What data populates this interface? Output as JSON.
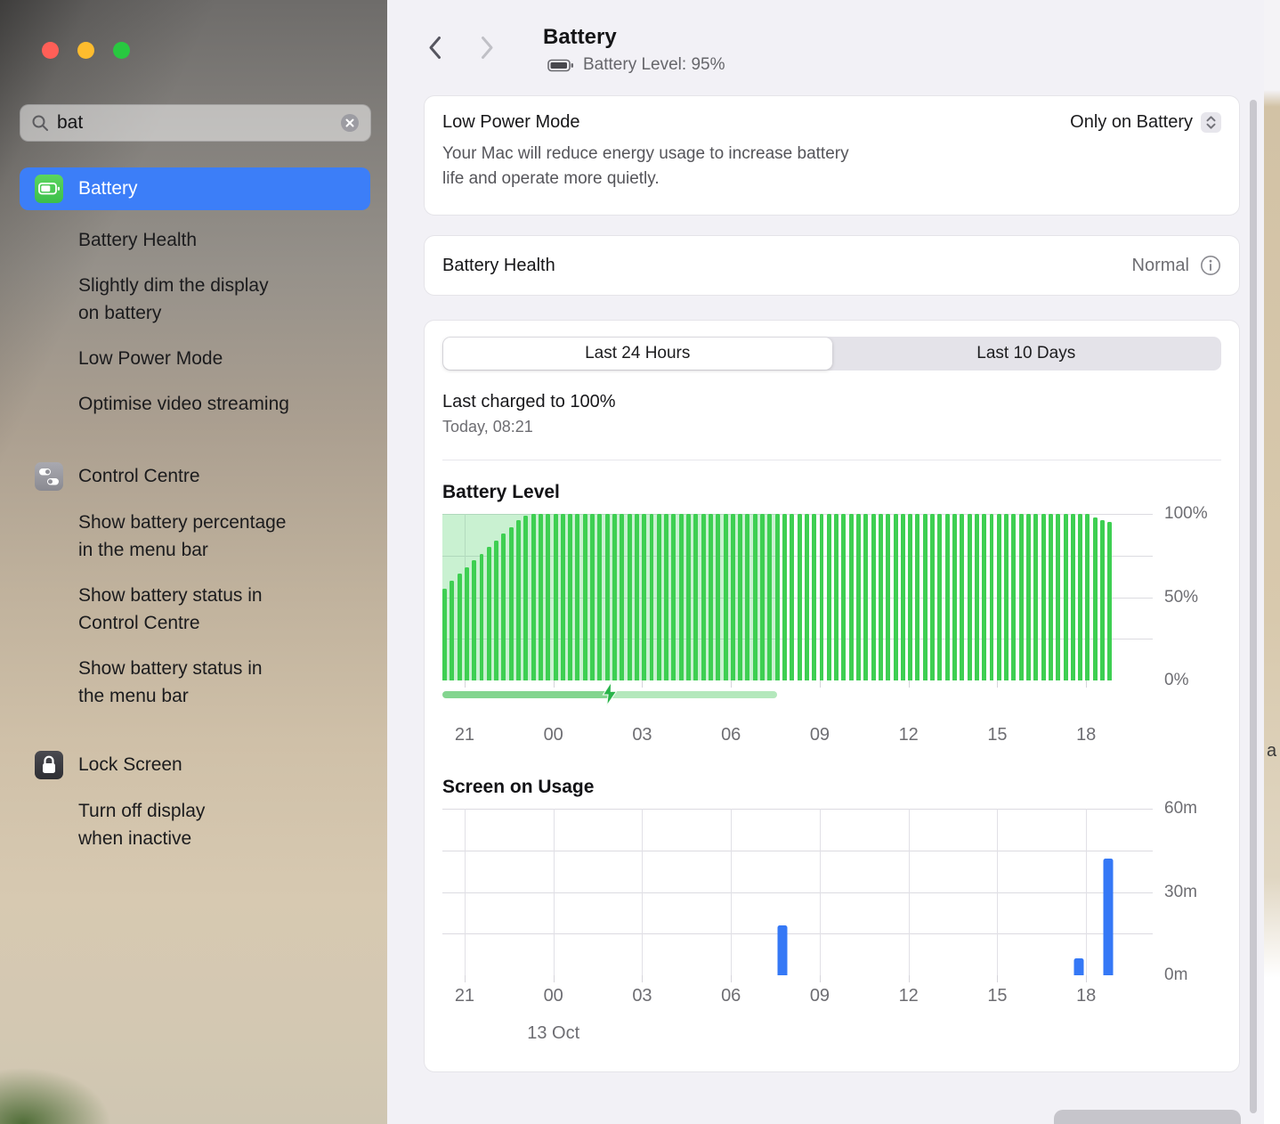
{
  "window": {
    "accent_color": "#3c7ef8",
    "traffic_lights": {
      "close": "#ff5f57",
      "minimize": "#febc2e",
      "zoom": "#28c840"
    }
  },
  "sidebar": {
    "search": {
      "value": "bat"
    },
    "items": [
      {
        "label": "Battery",
        "icon": "battery",
        "selected": true
      },
      {
        "label": "Battery Health"
      },
      {
        "label": "Slightly dim the display\non battery"
      },
      {
        "label": "Low Power Mode"
      },
      {
        "label": "Optimise video streaming"
      },
      {
        "label": "Control Centre",
        "icon": "control-centre"
      },
      {
        "label": "Show battery percentage\nin the menu bar"
      },
      {
        "label": "Show battery status in\nControl Centre"
      },
      {
        "label": "Show battery status in\nthe menu bar"
      },
      {
        "label": "Lock Screen",
        "icon": "lock"
      },
      {
        "label": "Turn off display\nwhen inactive"
      }
    ]
  },
  "main": {
    "title": "Battery",
    "battery_status": "Battery Level: 95%",
    "low_power_mode": {
      "label": "Low Power Mode",
      "value": "Only on Battery",
      "description": "Your Mac will reduce energy usage to increase battery\nlife and operate more quietly."
    },
    "battery_health": {
      "label": "Battery Health",
      "value": "Normal"
    },
    "usage_card": {
      "tabs": [
        "Last 24 Hours",
        "Last 10 Days"
      ],
      "selected_tab": "Last 24 Hours",
      "last_charged": "Last charged to 100%",
      "last_charged_time": "Today, 08:21"
    }
  },
  "desktop": {
    "text_fragment": "a"
  },
  "chart_data": [
    {
      "type": "bar",
      "title": "Battery Level",
      "x_span_hours": 24,
      "x_ticks": [
        "21",
        "00",
        "03",
        "06",
        "09",
        "12",
        "15",
        "18"
      ],
      "x_tick_start_frac": 0.03125,
      "x_tick_step_frac": 0.125,
      "y_ticks": [
        "100%",
        "50%",
        "0%"
      ],
      "ylim": [
        0,
        100
      ],
      "grid": true,
      "bar_color": "#3ecf52",
      "values": [
        55,
        60,
        64,
        68,
        72,
        76,
        80,
        84,
        88,
        92,
        96,
        99,
        100,
        100,
        100,
        100,
        100,
        100,
        100,
        100,
        100,
        100,
        100,
        100,
        100,
        100,
        100,
        100,
        100,
        100,
        100,
        100,
        100,
        100,
        100,
        100,
        100,
        100,
        100,
        100,
        100,
        100,
        100,
        100,
        100,
        100,
        100,
        100,
        100,
        100,
        100,
        100,
        100,
        100,
        100,
        100,
        100,
        100,
        100,
        100,
        100,
        100,
        100,
        100,
        100,
        100,
        100,
        100,
        100,
        100,
        100,
        100,
        100,
        100,
        100,
        100,
        100,
        100,
        100,
        100,
        100,
        100,
        100,
        100,
        100,
        100,
        100,
        100,
        98,
        96,
        95
      ],
      "charging_overlay": {
        "from_frac": 0,
        "to_frac": 0.471,
        "color": "rgba(76,207,103,0.30)"
      },
      "charging_strip": {
        "from_frac": 0,
        "to_frac": 0.471,
        "bolt_frac": 0.235,
        "color_left": "#83d58f",
        "color_right": "#b4e8bc",
        "bolt_color": "#29b44a"
      }
    },
    {
      "type": "bar",
      "title": "Screen on Usage",
      "x_span_hours": 24,
      "x_ticks": [
        "21",
        "00",
        "03",
        "06",
        "09",
        "12",
        "15",
        "18"
      ],
      "x_tick_start_frac": 0.03125,
      "x_tick_step_frac": 0.125,
      "date_label": "13 Oct",
      "y_ticks": [
        "60m",
        "30m",
        "0m"
      ],
      "ylim": [
        0,
        60
      ],
      "grid": true,
      "bar_color": "#3578f6",
      "bars": [
        {
          "time": "07:45",
          "minutes": 18,
          "x_frac": 0.479
        },
        {
          "time": "17:45",
          "minutes": 6,
          "x_frac": 0.896
        },
        {
          "time": "18:45",
          "minutes": 42,
          "x_frac": 0.937
        }
      ]
    }
  ]
}
